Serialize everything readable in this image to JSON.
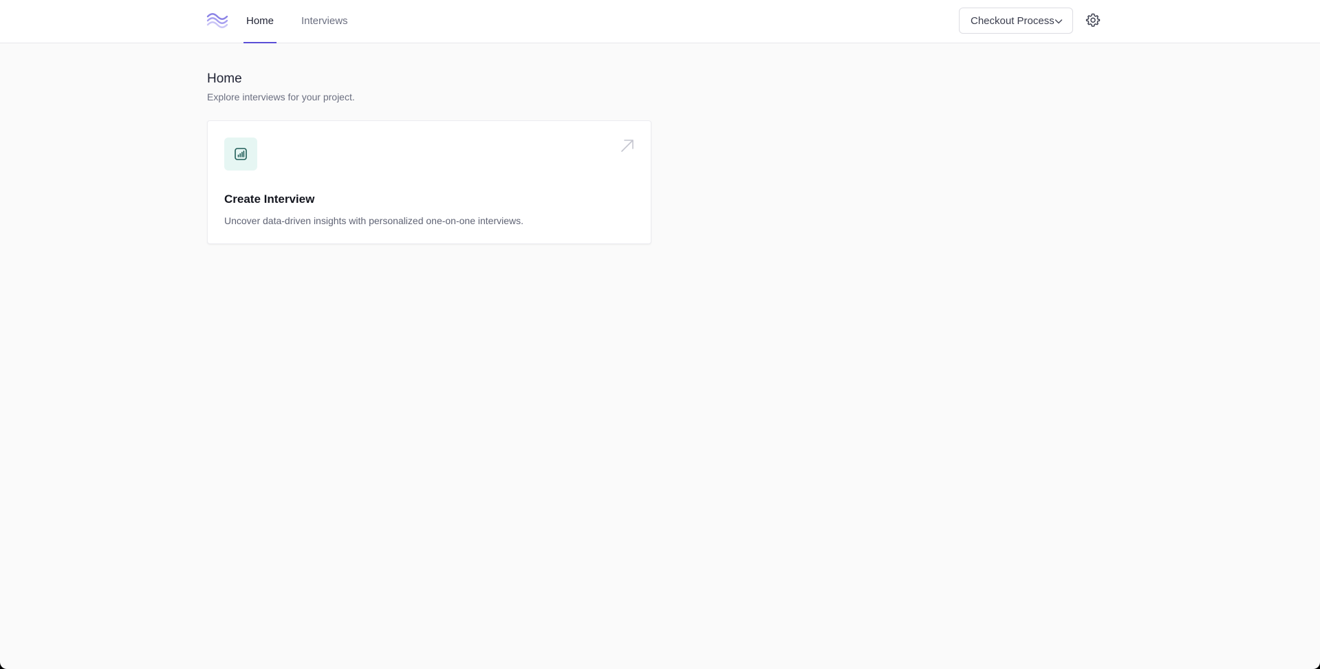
{
  "topbar": {
    "logo_icon": "wave-logo-icon",
    "tabs": [
      {
        "label": "Home",
        "active": true
      },
      {
        "label": "Interviews",
        "active": false
      }
    ],
    "project_select": {
      "value": "Checkout Process",
      "icon": "chevron-down-icon"
    },
    "settings_icon": "gear-icon"
  },
  "page": {
    "title": "Home",
    "subtitle": "Explore interviews for your project."
  },
  "card": {
    "icon": "bar-chart-icon",
    "arrow_icon": "arrow-up-right-icon",
    "title": "Create Interview",
    "description": "Uncover data-driven insights with personalized one-on-one interviews."
  },
  "colors": {
    "accent": "#5a4fd6",
    "logo": "#8b83e6",
    "icon_bg": "#e6f6f3",
    "icon_fg": "#1f5d57",
    "background": "#fafafa"
  }
}
